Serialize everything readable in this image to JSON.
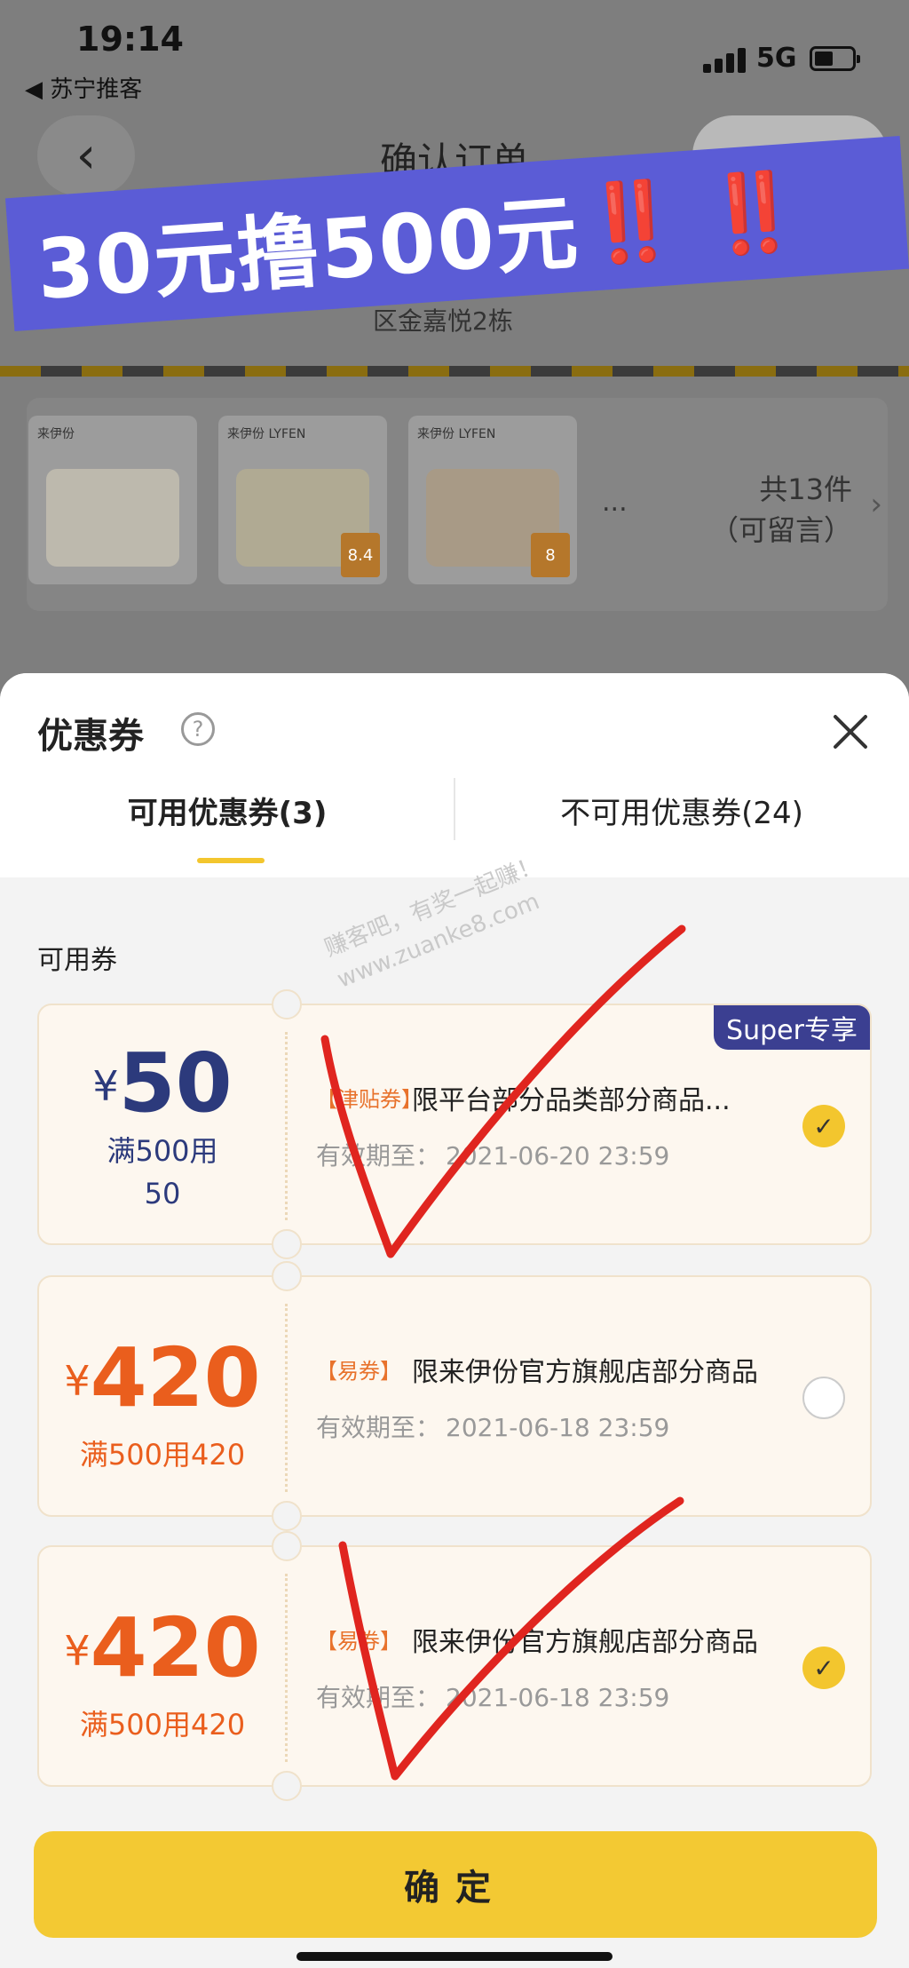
{
  "status_bar": {
    "time": "19:14",
    "back_app": "◀ 苏宁推客",
    "network": "5G"
  },
  "nav": {
    "back_glyph": "‹",
    "title": "确认订单",
    "capsule_more": "•••",
    "capsule_target": "◉"
  },
  "promo": {
    "text": "30元撸500元",
    "marks": "‼️ ‼️"
  },
  "address_tail": "区金嘉悦2栋",
  "order": {
    "products": [
      {
        "brand": "来伊份",
        "tag": ""
      },
      {
        "brand": "来伊份 LYFEN",
        "tag": "8.4"
      },
      {
        "brand": "来伊份 LYFEN",
        "tag": "8"
      }
    ],
    "ellipsis": "...",
    "count": "共13件",
    "note": "（可留言）"
  },
  "sheet": {
    "title": "优惠券",
    "help_glyph": "?",
    "tabs": [
      {
        "label": "可用优惠券(3)",
        "active": true
      },
      {
        "label": "不可用优惠券(24)",
        "active": false
      }
    ],
    "section_label": "可用券",
    "watermark_lines": [
      "赚客吧，有奖一起赚！",
      "www.zuanke8.com"
    ],
    "coupons": [
      {
        "currency": "¥",
        "amount": "50",
        "condition_lines": [
          "满500用",
          "50"
        ],
        "type": "【津贴券】",
        "description": "限平台部分品类部分商品...",
        "valid_label": "有效期至：",
        "valid_date": "2021-06-20 23:59",
        "badge": "Super专享",
        "selected": true,
        "amount_color": "#2c3a7c"
      },
      {
        "currency": "¥",
        "amount": "420",
        "condition_lines": [
          "满500用420"
        ],
        "type": "【易券】",
        "description": "限来伊份官方旗舰店部分商品",
        "valid_label": "有效期至：",
        "valid_date": "2021-06-18 23:59",
        "badge": "",
        "selected": false,
        "amount_color": "#ea5e1d"
      },
      {
        "currency": "¥",
        "amount": "420",
        "condition_lines": [
          "满500用420"
        ],
        "type": "【易券】",
        "description": "限来伊份官方旗舰店部分商品",
        "valid_label": "有效期至：",
        "valid_date": "2021-06-18 23:59",
        "badge": "",
        "selected": true,
        "amount_color": "#ea5e1d"
      }
    ],
    "check_glyph": "✓",
    "confirm_label": "确定"
  },
  "colors": {
    "accent_yellow": "#f3c933",
    "promo_banner": "#5b5cd6",
    "annotation_red": "#e0251f"
  }
}
